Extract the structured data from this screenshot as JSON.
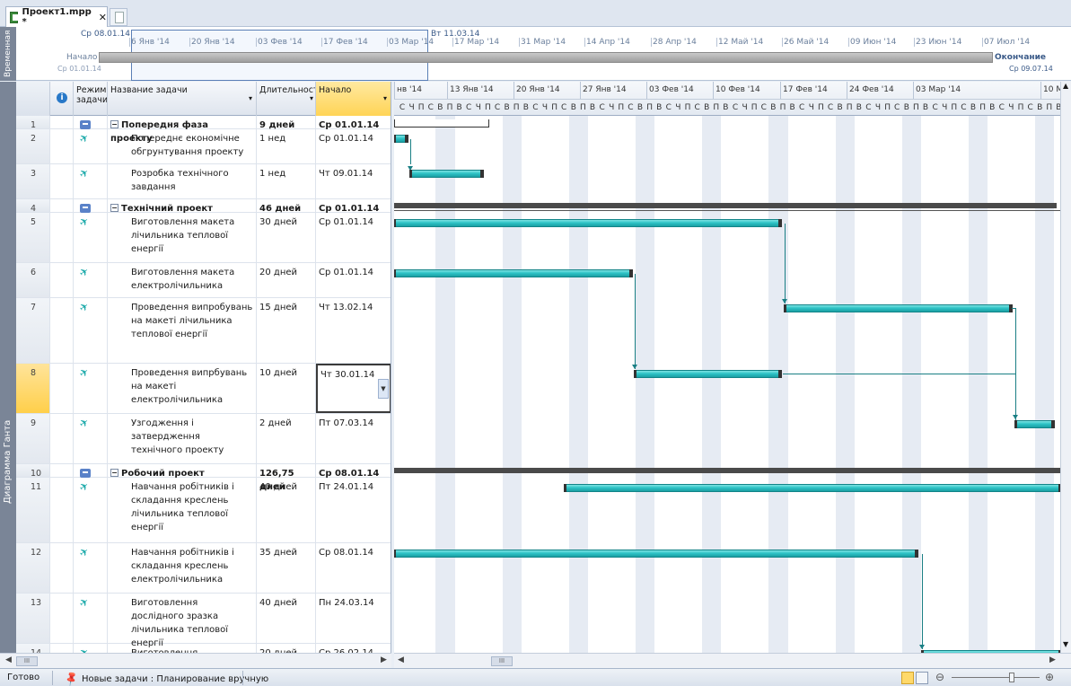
{
  "tab": {
    "title": "Проект1.mpp *",
    "close": "✕"
  },
  "timeline": {
    "side_label": "Временная шкала",
    "window_start": "Ср 08.01.14",
    "window_end": "Вт 11.03.14",
    "start_label": "Начало",
    "start_date": "Ср 01.01.14",
    "end_label": "Окончание",
    "end_date": "Ср 09.07.14",
    "ticks": [
      "6 Янв '14",
      "20 Янв '14",
      "03 Фев '14",
      "17 Фев '14",
      "03 Мар '14",
      "17 Мар '14",
      "31 Мар '14",
      "14 Апр '14",
      "28 Апр '14",
      "12 Май '14",
      "26 Май '14",
      "09 Июн '14",
      "23 Июн '14",
      "07 Июл '14"
    ]
  },
  "left_strip": {
    "label": "Диаграмма Ганта"
  },
  "grid": {
    "headers": {
      "mode": "Режим задачи",
      "name": "Название задачи",
      "duration": "Длительность",
      "start": "Начало"
    },
    "rows": [
      {
        "id": "1",
        "mode": "auto",
        "name": "Попередня фаза проекту",
        "duration": "9 дней",
        "start": "Ср 01.01.14",
        "summary": true
      },
      {
        "id": "2",
        "mode": "manual",
        "name": "Попереднє економічне обгрунтування проекту",
        "duration": "1 нед",
        "start": "Ср 01.01.14"
      },
      {
        "id": "3",
        "mode": "manual",
        "name": "Розробка технічного завдання",
        "duration": "1 нед",
        "start": "Чт 09.01.14"
      },
      {
        "id": "4",
        "mode": "auto",
        "name": "Технічний проект",
        "duration": "46 дней",
        "start": "Ср 01.01.14",
        "summary": true
      },
      {
        "id": "5",
        "mode": "manual",
        "name": "Виготовлення макета лічильника теплової енергії",
        "duration": "30 дней",
        "start": "Ср 01.01.14"
      },
      {
        "id": "6",
        "mode": "manual",
        "name": "Виготовлення макета електролічильника",
        "duration": "20 дней",
        "start": "Ср 01.01.14"
      },
      {
        "id": "7",
        "mode": "manual",
        "name": "Проведення випробувань на макеті лічильника теплової енергії",
        "duration": "15 дней",
        "start": "Чт 13.02.14"
      },
      {
        "id": "8",
        "mode": "manual",
        "name": "Проведення випрбувань на макеті електролічильника",
        "duration": "10 дней",
        "start": "Чт 30.01.14",
        "selected": true
      },
      {
        "id": "9",
        "mode": "manual",
        "name": "Узгодження і затвердження технічного проекту",
        "duration": "2 дней",
        "start": "Пт 07.03.14"
      },
      {
        "id": "10",
        "mode": "auto",
        "name": "Робочий проект",
        "duration": "126,75 дней",
        "start": "Ср 08.01.14",
        "summary": true
      },
      {
        "id": "11",
        "mode": "manual",
        "name": "Навчання робітників і складання креслень лічильника теплової енергії",
        "duration": "40 дней",
        "start": "Пт 24.01.14"
      },
      {
        "id": "12",
        "mode": "manual",
        "name": "Навчання робітників і складання креслень електролічильника",
        "duration": "35 дней",
        "start": "Ср 08.01.14"
      },
      {
        "id": "13",
        "mode": "manual",
        "name": "Виготовлення дослідного зразка лічильника теплової енергії",
        "duration": "40 дней",
        "start": "Пн 24.03.14"
      },
      {
        "id": "14",
        "mode": "manual",
        "name": "Виготовлення дослідного зразка",
        "duration": "20 дней",
        "start": "Ср 26.02.14"
      }
    ]
  },
  "gantt": {
    "weeks": [
      "нв '14",
      "13 Янв '14",
      "20 Янв '14",
      "27 Янв '14",
      "03 Фев '14",
      "10 Фев '14",
      "17 Фев '14",
      "24 Фев '14",
      "03 Мар '14",
      "10 М"
    ],
    "day_letters": [
      "С",
      "Ч",
      "П",
      "С",
      "В",
      "П",
      "В"
    ]
  },
  "status": {
    "ready": "Готово",
    "new_tasks": "Новые задачи : Планирование вручную"
  }
}
